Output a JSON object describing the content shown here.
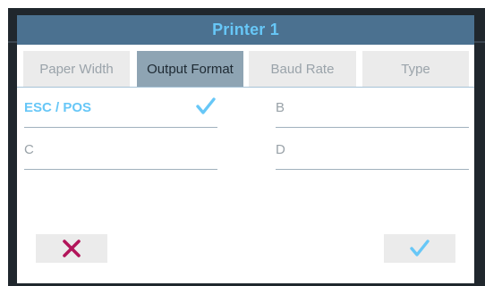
{
  "dialog": {
    "title": "Printer 1"
  },
  "tabs": [
    {
      "label": "Paper Width",
      "active": false
    },
    {
      "label": "Output Format",
      "active": true
    },
    {
      "label": "Baud Rate",
      "active": false
    },
    {
      "label": "Type",
      "active": false
    }
  ],
  "options": [
    {
      "label": "ESC / POS",
      "selected": true
    },
    {
      "label": "B",
      "selected": false
    },
    {
      "label": "C",
      "selected": false
    },
    {
      "label": "D",
      "selected": false
    }
  ],
  "footer": {
    "cancel_icon": "close-icon",
    "confirm_icon": "checkmark-icon"
  },
  "colors": {
    "titlebar": "#4b7190",
    "title_text": "#67c7f7",
    "active_tab": "#8ea4b3",
    "selected_option": "#67c7f7",
    "cancel_icon": "#b2155a",
    "confirm_icon": "#67c7f7"
  }
}
